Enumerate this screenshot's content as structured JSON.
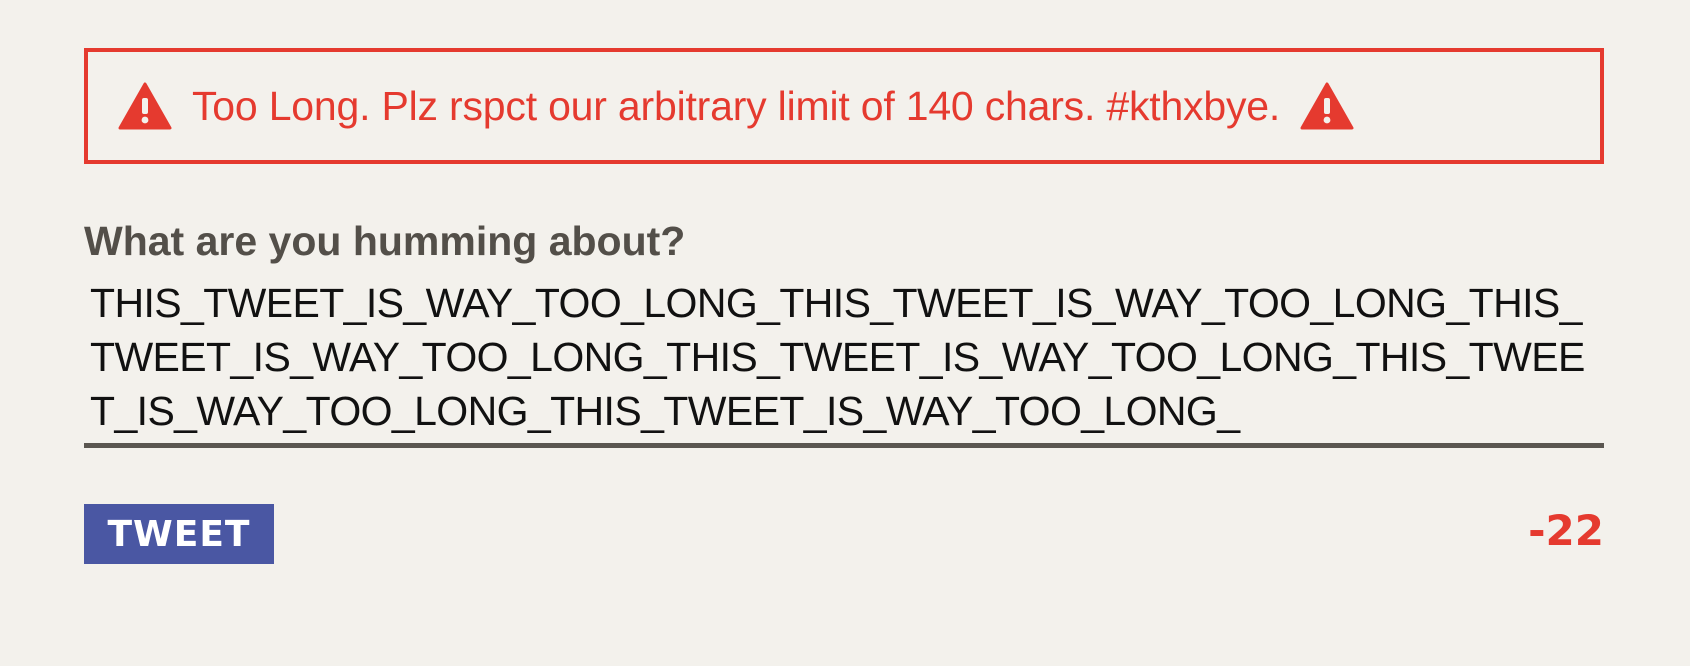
{
  "error": {
    "message": "Too Long. Plz rspct our arbitrary limit of 140 chars. #kthxbye.",
    "icon": "warning-icon",
    "color": "#e53a2f"
  },
  "composer": {
    "label": "What are you humming about?",
    "value": "THIS_TWEET_IS_WAY_TOO_LONG_THIS_TWEET_IS_WAY_TOO_LONG_THIS_TWEET_IS_WAY_TOO_LONG_THIS_TWEET_IS_WAY_TOO_LONG_THIS_TWEET_IS_WAY_TOO_LONG_THIS_TWEET_IS_WAY_TOO_LONG_"
  },
  "actions": {
    "tweet_label": "TWEET",
    "tweet_color": "#4a57a3"
  },
  "counter": {
    "remaining": "-22"
  }
}
